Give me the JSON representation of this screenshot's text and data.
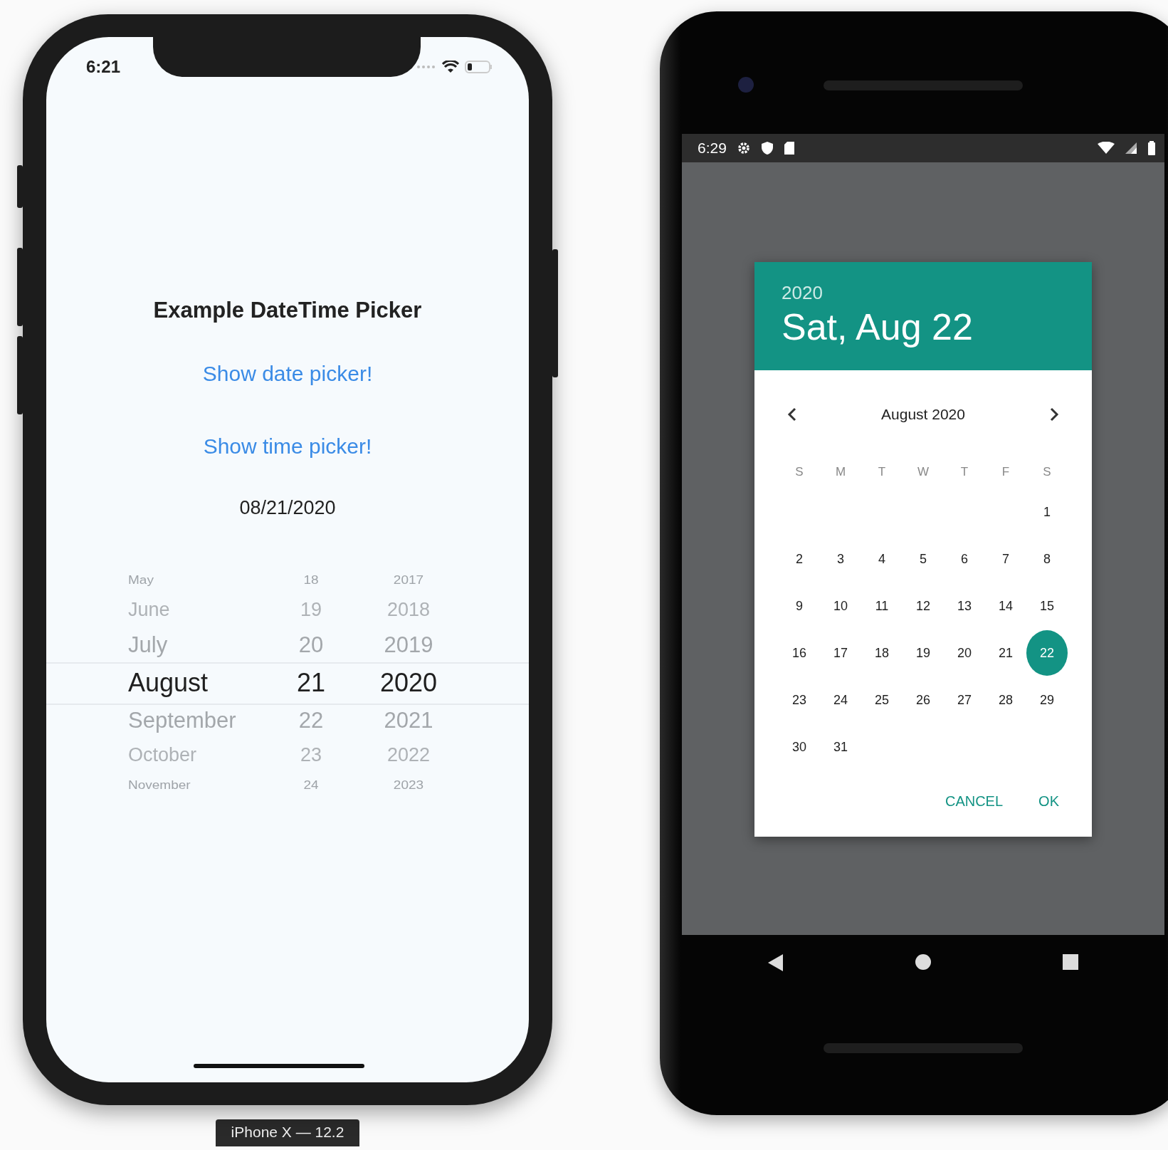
{
  "ios_device": {
    "status_bar": {
      "time": "6:21"
    },
    "title": "Example DateTime Picker",
    "buttons": [
      "Show date picker!",
      "Show time picker!"
    ],
    "date_value": "08/21/2020",
    "picker": {
      "columns": [
        {
          "kind": "month",
          "items": [
            {
              "label": "May",
              "selected": false
            },
            {
              "label": "June",
              "selected": false
            },
            {
              "label": "July",
              "selected": false
            },
            {
              "label": "August",
              "selected": true
            },
            {
              "label": "September",
              "selected": false
            },
            {
              "label": "October",
              "selected": false
            },
            {
              "label": "November",
              "selected": false
            }
          ]
        },
        {
          "kind": "day",
          "items": [
            {
              "label": "18",
              "selected": false
            },
            {
              "label": "19",
              "selected": false
            },
            {
              "label": "20",
              "selected": false
            },
            {
              "label": "21",
              "selected": true
            },
            {
              "label": "22",
              "selected": false
            },
            {
              "label": "23",
              "selected": false
            },
            {
              "label": "24",
              "selected": false
            }
          ]
        },
        {
          "kind": "year",
          "items": [
            {
              "label": "2017",
              "selected": false
            },
            {
              "label": "2018",
              "selected": false
            },
            {
              "label": "2019",
              "selected": false
            },
            {
              "label": "2020",
              "selected": true
            },
            {
              "label": "2021",
              "selected": false
            },
            {
              "label": "2022",
              "selected": false
            },
            {
              "label": "2023",
              "selected": false
            }
          ]
        }
      ]
    },
    "device_label": "iPhone X — 12.2"
  },
  "android_device": {
    "status_bar": {
      "time": "6:29"
    },
    "dialog": {
      "year": "2020",
      "date": "Sat, Aug 22",
      "month": "August 2020",
      "weekdays": [
        "S",
        "M",
        "T",
        "W",
        "T",
        "F",
        "S"
      ],
      "weeks": [
        [
          {
            "label": "1",
            "selected": false
          }
        ],
        [
          {
            "label": "2",
            "selected": false
          },
          {
            "label": "3",
            "selected": false
          },
          {
            "label": "4",
            "selected": false
          },
          {
            "label": "5",
            "selected": false
          },
          {
            "label": "6",
            "selected": false
          },
          {
            "label": "7",
            "selected": false
          },
          {
            "label": "8",
            "selected": false
          }
        ],
        [
          {
            "label": "9",
            "selected": false
          },
          {
            "label": "10",
            "selected": false
          },
          {
            "label": "11",
            "selected": false
          },
          {
            "label": "12",
            "selected": false
          },
          {
            "label": "13",
            "selected": false
          },
          {
            "label": "14",
            "selected": false
          },
          {
            "label": "15",
            "selected": false
          }
        ],
        [
          {
            "label": "16",
            "selected": false
          },
          {
            "label": "17",
            "selected": false
          },
          {
            "label": "18",
            "selected": false
          },
          {
            "label": "19",
            "selected": false
          },
          {
            "label": "20",
            "selected": false
          },
          {
            "label": "21",
            "selected": false
          },
          {
            "label": "22",
            "selected": true
          }
        ],
        [
          {
            "label": "23",
            "selected": false
          },
          {
            "label": "24",
            "selected": false
          },
          {
            "label": "25",
            "selected": false
          },
          {
            "label": "26",
            "selected": false
          },
          {
            "label": "27",
            "selected": false
          },
          {
            "label": "28",
            "selected": false
          },
          {
            "label": "29",
            "selected": false
          }
        ],
        [
          {
            "label": "30",
            "selected": false
          },
          {
            "label": "31",
            "selected": false
          }
        ]
      ],
      "buttons": [
        "CANCEL",
        "OK"
      ]
    }
  }
}
